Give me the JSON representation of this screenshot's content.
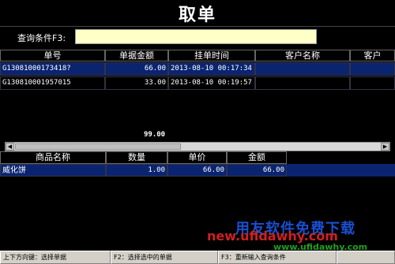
{
  "window": {
    "title": "取单"
  },
  "query": {
    "label": "查询条件F3:",
    "value": ""
  },
  "orders": {
    "columns": [
      "单号",
      "单据金额",
      "挂单时间",
      "客户名称",
      "客户"
    ],
    "rows": [
      {
        "no": "G13081000173418?",
        "amount": "66.00",
        "time": "2013-08-10 00:17:34",
        "customer": "",
        "customer2": ""
      },
      {
        "no": "G130810001957015",
        "amount": "33.00",
        "time": "2013-08-10 00:19:57",
        "customer": "",
        "customer2": ""
      }
    ],
    "total": "99.00"
  },
  "items": {
    "columns": [
      "商品名称",
      "数量",
      "单价",
      "金额"
    ],
    "rows": [
      {
        "name": "威化饼",
        "qty": "1.00",
        "price": "66.00",
        "amount": "66.00"
      }
    ]
  },
  "watermark": {
    "line1": "用友软件免费下载",
    "line2": "new.ufidawhy.com",
    "line3": "www.ufidawhy.com"
  },
  "status": {
    "segments": [
      "上下方向键：选择单据",
      "F2：选择选中的单据",
      "F3：重新输入查询条件",
      ""
    ]
  },
  "colors": {
    "selected_row": "#0a2470",
    "query_bg": "#ffffc8",
    "background": "#000000"
  }
}
